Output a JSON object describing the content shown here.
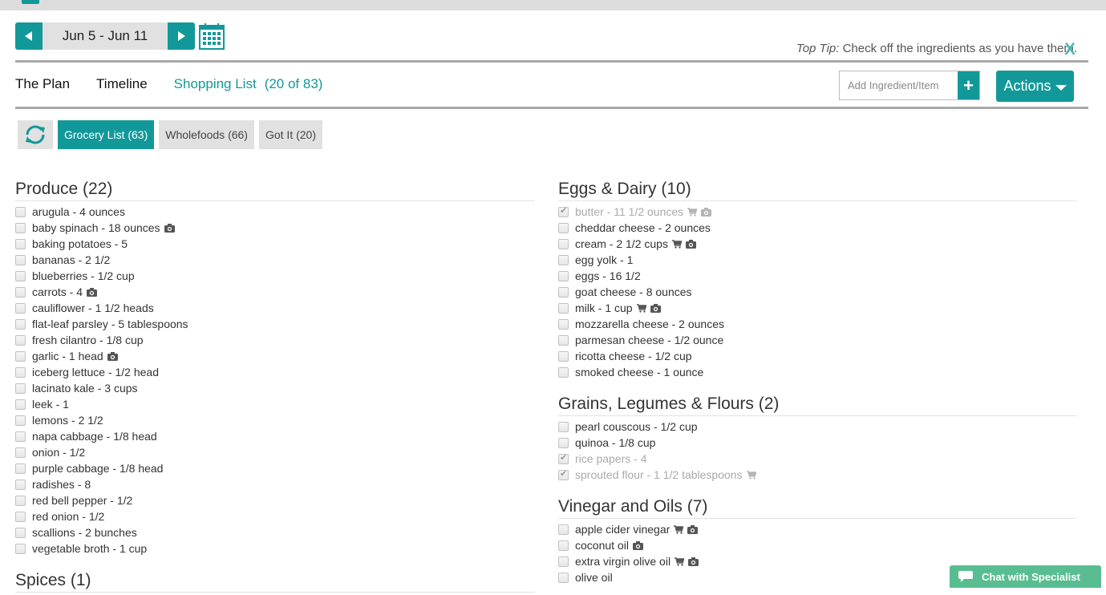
{
  "header": {
    "date_range": "Jun 5 - Jun 11",
    "prev_icon": "triangle-left-icon",
    "next_icon": "triangle-right-icon",
    "calendar_icon": "calendar-icon"
  },
  "tip": {
    "label": "Top Tip:",
    "text": " Check off the ingredients as you have them.",
    "close": "X"
  },
  "tabs": [
    {
      "label": "The Plan",
      "active": false
    },
    {
      "label": "Timeline",
      "active": false
    },
    {
      "label": "Shopping List",
      "count": "(20 of 83)",
      "active": true
    }
  ],
  "add_item": {
    "placeholder": "Add Ingredient/Item",
    "button": "+"
  },
  "actions": {
    "label": "Actions"
  },
  "filters": [
    {
      "label": "Grocery List (63)",
      "active": true
    },
    {
      "label": "Wholefoods (66)",
      "active": false
    },
    {
      "label": "Got It (20)",
      "active": false
    }
  ],
  "colors": {
    "accent": "#13989a",
    "chat": "#59bd92"
  },
  "left_sections": [
    {
      "title": "Produce (22)",
      "items": [
        {
          "text": "arugula - 4 ounces"
        },
        {
          "text": "baby spinach - 18 ounces",
          "camera": true
        },
        {
          "text": "baking potatoes - 5"
        },
        {
          "text": "bananas - 2 1/2"
        },
        {
          "text": "blueberries - 1/2 cup"
        },
        {
          "text": "carrots - 4",
          "camera": true
        },
        {
          "text": "cauliflower - 1 1/2 heads"
        },
        {
          "text": "flat-leaf parsley - 5 tablespoons"
        },
        {
          "text": "fresh cilantro - 1/8 cup"
        },
        {
          "text": "garlic - 1 head",
          "camera": true
        },
        {
          "text": "iceberg lettuce - 1/2 head"
        },
        {
          "text": "lacinato kale - 3 cups"
        },
        {
          "text": "leek - 1"
        },
        {
          "text": "lemons - 2 1/2"
        },
        {
          "text": "napa cabbage - 1/8 head"
        },
        {
          "text": "onion - 1/2"
        },
        {
          "text": "purple cabbage - 1/8 head"
        },
        {
          "text": "radishes - 8"
        },
        {
          "text": "red bell pepper - 1/2"
        },
        {
          "text": "red onion - 1/2"
        },
        {
          "text": "scallions - 2 bunches"
        },
        {
          "text": "vegetable broth - 1 cup"
        }
      ]
    },
    {
      "title": "Spices (1)",
      "items": []
    }
  ],
  "right_sections": [
    {
      "title": "Eggs & Dairy (10)",
      "items": [
        {
          "text": "butter - 11 1/2 ounces",
          "checked": true,
          "cart": true,
          "camera": true
        },
        {
          "text": "cheddar cheese - 2 ounces"
        },
        {
          "text": "cream - 2 1/2 cups",
          "cart": true,
          "camera": true
        },
        {
          "text": "egg yolk - 1"
        },
        {
          "text": "eggs - 16 1/2"
        },
        {
          "text": "goat cheese - 8 ounces"
        },
        {
          "text": "milk - 1 cup",
          "cart": true,
          "camera": true
        },
        {
          "text": "mozzarella cheese - 2 ounces"
        },
        {
          "text": "parmesan cheese - 1/2 ounce"
        },
        {
          "text": "ricotta cheese - 1/2 cup"
        },
        {
          "text": "smoked cheese - 1 ounce"
        }
      ]
    },
    {
      "title": "Grains, Legumes & Flours (2)",
      "items": [
        {
          "text": "pearl couscous - 1/2 cup"
        },
        {
          "text": "quinoa - 1/8 cup"
        },
        {
          "text": "rice papers - 4",
          "checked": true
        },
        {
          "text": "sprouted flour - 1 1/2 tablespoons",
          "checked": true,
          "cart": true
        }
      ]
    },
    {
      "title": "Vinegar and Oils (7)",
      "items": [
        {
          "text": "apple cider vinegar",
          "cart": true,
          "camera": true
        },
        {
          "text": "coconut oil",
          "camera": true
        },
        {
          "text": "extra virgin olive oil",
          "cart": true,
          "camera": true
        },
        {
          "text": "olive oil"
        }
      ]
    }
  ],
  "chat": {
    "label": "Chat with Specialist"
  }
}
